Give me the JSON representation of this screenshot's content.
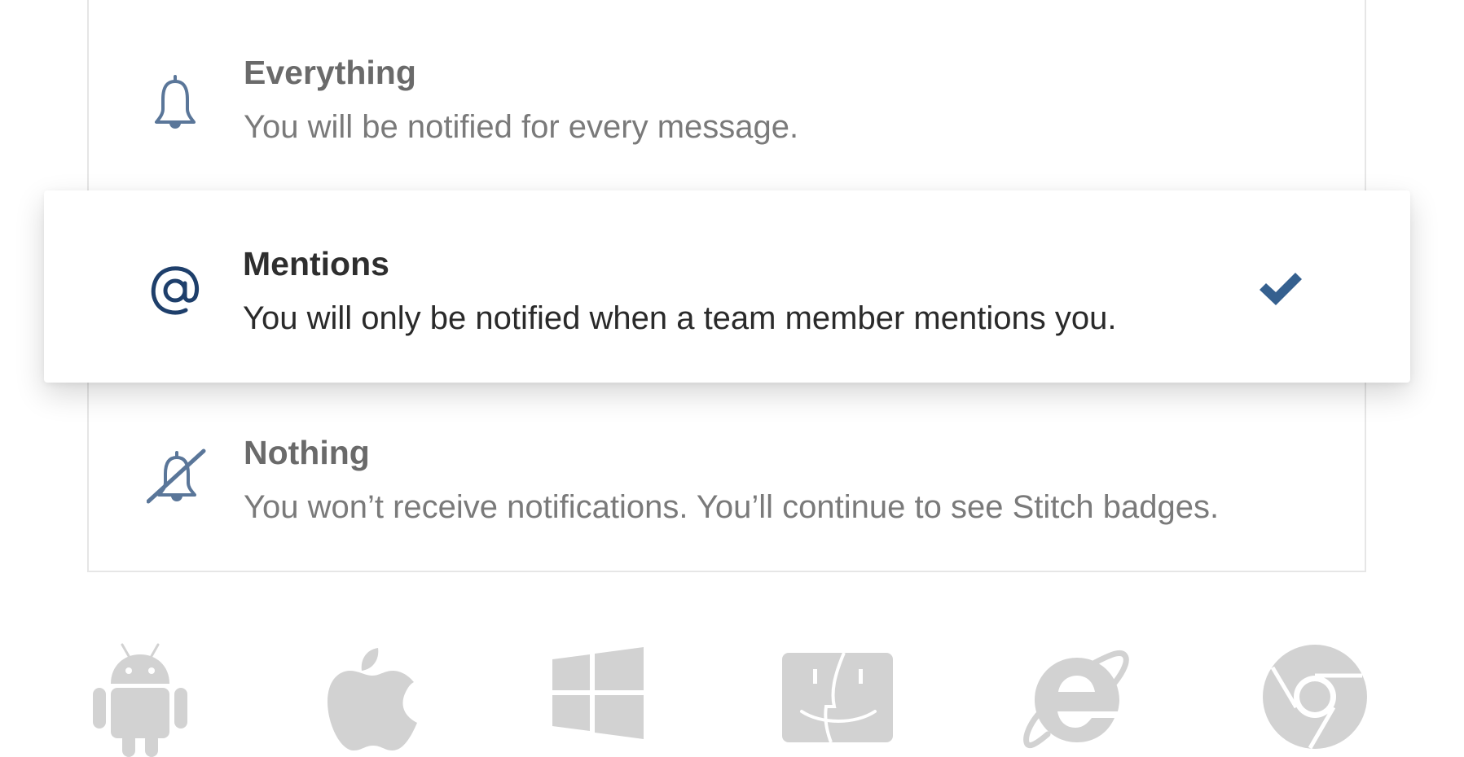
{
  "notification_options": [
    {
      "id": "everything",
      "icon": "bell-icon",
      "title": "Everything",
      "description": "You will be notified for every message.",
      "selected": false
    },
    {
      "id": "mentions",
      "icon": "at-sign-icon",
      "title": "Mentions",
      "description": "You will only be notified when a team member mentions you.",
      "selected": true
    },
    {
      "id": "nothing",
      "icon": "bell-slash-icon",
      "title": "Nothing",
      "description": "You won’t receive notifications. You’ll continue to see Stitch badges.",
      "selected": false
    }
  ],
  "platforms": [
    {
      "icon": "android-icon"
    },
    {
      "icon": "apple-icon"
    },
    {
      "icon": "windows-icon"
    },
    {
      "icon": "finder-icon"
    },
    {
      "icon": "internet-explorer-icon"
    },
    {
      "icon": "chrome-icon"
    }
  ],
  "colors": {
    "accent": "#35608f",
    "icon_muted": "#5a7699",
    "at_sign": "#1e3f6b",
    "platform_gray": "#d2d2d2",
    "border": "#e6e6e6"
  }
}
